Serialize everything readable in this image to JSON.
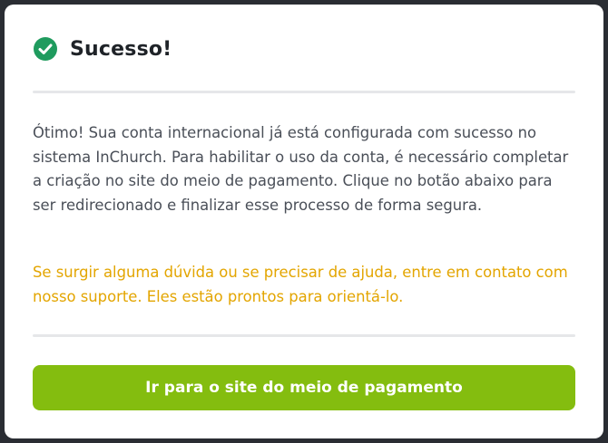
{
  "dialog": {
    "title": "Sucesso!",
    "title_icon": "check-circle-icon",
    "message": "Ótimo! Sua conta internacional já está configurada com sucesso no sistema InChurch. Para habilitar o uso da conta, é necessário completar a criação no site do meio de pagamento. Clique no botão abaixo para ser redirecionado e finalizar esse processo de forma segura.",
    "help_message": "Se surgir alguma dúvida ou se precisar de ajuda, entre em contato com nosso suporte. Eles estão prontos para orientá-lo.",
    "primary_button_label": "Ir para o site do meio de pagamento"
  },
  "colors": {
    "success": "#1f9b5e",
    "help_text": "#e3a500",
    "primary_button": "#84bd0f",
    "backdrop": "#2a2d33"
  }
}
